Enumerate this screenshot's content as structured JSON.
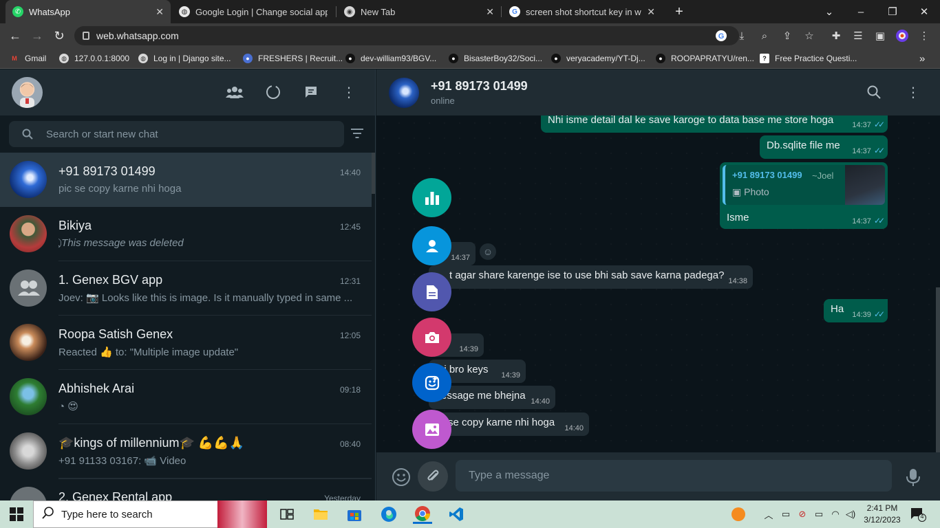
{
  "browser": {
    "tabs": [
      {
        "title": "WhatsApp",
        "active": true
      },
      {
        "title": "Google Login | Change social app",
        "active": false
      },
      {
        "title": "New Tab",
        "active": false
      },
      {
        "title": "screen shot shortcut key in windo",
        "active": false
      }
    ],
    "url": "web.whatsapp.com",
    "bookmarks": [
      "Gmail",
      "127.0.0.1:8000",
      "Log in | Django site...",
      "FRESHERS | Recruit...",
      "dev-william93/BGV...",
      "BisasterBoy32/Soci...",
      "veryacademy/YT-Dj...",
      "ROOPAPRATYU/ren...",
      "Free Practice Questi..."
    ]
  },
  "sidebar": {
    "search_placeholder": "Search or start new chat",
    "chats": [
      {
        "name": "+91 89173 01499",
        "time": "14:40",
        "preview": "pic se copy karne nhi hoga",
        "active": true
      },
      {
        "name": "Bikiya",
        "time": "12:45",
        "preview": "This message was deleted"
      },
      {
        "name": "1. Genex BGV app",
        "time": "12:31",
        "preview": "Joev: 📷 Looks like this is image. Is it manually typed in same ..."
      },
      {
        "name": "Roopa Satish Genex",
        "time": "12:05",
        "preview": "Reacted 👍 to: \"Multiple image update\""
      },
      {
        "name": "Abhishek Arai",
        "time": "09:18",
        "preview": "😍"
      },
      {
        "name": "🎓kings of millennium🎓 💪💪🙏",
        "time": "08:40",
        "preview": "+91 91133 03167: 📹 Video"
      },
      {
        "name": "2. Genex Rental app",
        "time": "Yesterday",
        "preview": ""
      }
    ]
  },
  "conversation": {
    "contact_name": "+91 89173 01499",
    "contact_status": "online",
    "messages": [
      {
        "dir": "out",
        "text": "Nhi isme detail dal ke save karoge to data base me store hoga",
        "time": "14:37"
      },
      {
        "dir": "out",
        "text": "Db.sqlite file me",
        "time": "14:37"
      },
      {
        "dir": "out",
        "quote_author": "+91 89173 01499",
        "quote_alias": "~Joel",
        "quote_type": "Photo",
        "text": "Isme",
        "time": "14:37"
      },
      {
        "dir": "in",
        "text": "",
        "time": "14:37"
      },
      {
        "dir": "in",
        "text": "t agar share karenge ise to use bhi sab save karna padega?",
        "time": "14:38"
      },
      {
        "dir": "out",
        "text": "Ha",
        "time": "14:39"
      },
      {
        "dir": "in",
        "text": "a",
        "time": "14:39"
      },
      {
        "dir": "in",
        "text": "ej bro keys",
        "time": "14:39"
      },
      {
        "dir": "in",
        "text": "essage me bhejna",
        "time": "14:40"
      },
      {
        "dir": "in",
        "text": "se copy karne nhi hoga",
        "time": "14:40"
      }
    ],
    "composer_placeholder": "Type a message"
  },
  "attach_menu": [
    {
      "icon": "poll-icon",
      "color": "#02a698"
    },
    {
      "icon": "contact-icon",
      "color": "#0795dc"
    },
    {
      "icon": "document-icon",
      "color": "#5157ae"
    },
    {
      "icon": "camera-icon",
      "color": "#d3396d"
    },
    {
      "icon": "sticker-icon",
      "color": "#0063cb"
    },
    {
      "icon": "gallery-icon",
      "color": "#bf59cf"
    }
  ],
  "taskbar": {
    "search_placeholder": "Type here to search",
    "time": "2:41 PM",
    "date": "3/12/2023",
    "notification_count": "4"
  },
  "colors": {
    "accent": "#00a884",
    "outgoing_bubble": "#005c4b",
    "incoming_bubble": "#202c33",
    "tick_read": "#53bdeb"
  }
}
